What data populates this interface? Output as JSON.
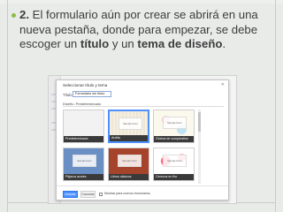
{
  "slide": {
    "number": "2.",
    "text_1": " El formulario aún por crear se abrirá en una nueva pestaña, donde para empezar, se debe escoger un ",
    "bold_1": "título",
    "text_2": " y un ",
    "bold_2": "tema de diseño",
    "text_3": "."
  },
  "dialog": {
    "title": "Seleccionar título y tema",
    "title_label": "Título",
    "title_value": "Formulario sin título",
    "theme_label": "Diseño. Predeterminado",
    "themes": [
      {
        "label": "Predeterminado",
        "sample": ""
      },
      {
        "label": "Arcilla",
        "sample": "Sample Form"
      },
      {
        "label": "Globos de cumpleaños",
        "sample": "Sample Form"
      },
      {
        "label": "Pájaros azules",
        "sample": "Sample Form"
      },
      {
        "label": "Libros clásicos",
        "sample": "Sample Form"
      },
      {
        "label": "Cerezos en flor",
        "sample": "Sample Form"
      }
    ],
    "accept_label": "Aceptar",
    "cancel_label": "Cancelar",
    "checkbox_label": "Mostrar para nuevos formularios"
  },
  "colors": {
    "bullet": "#8dbb48",
    "accent_button": "#4d90fe"
  }
}
